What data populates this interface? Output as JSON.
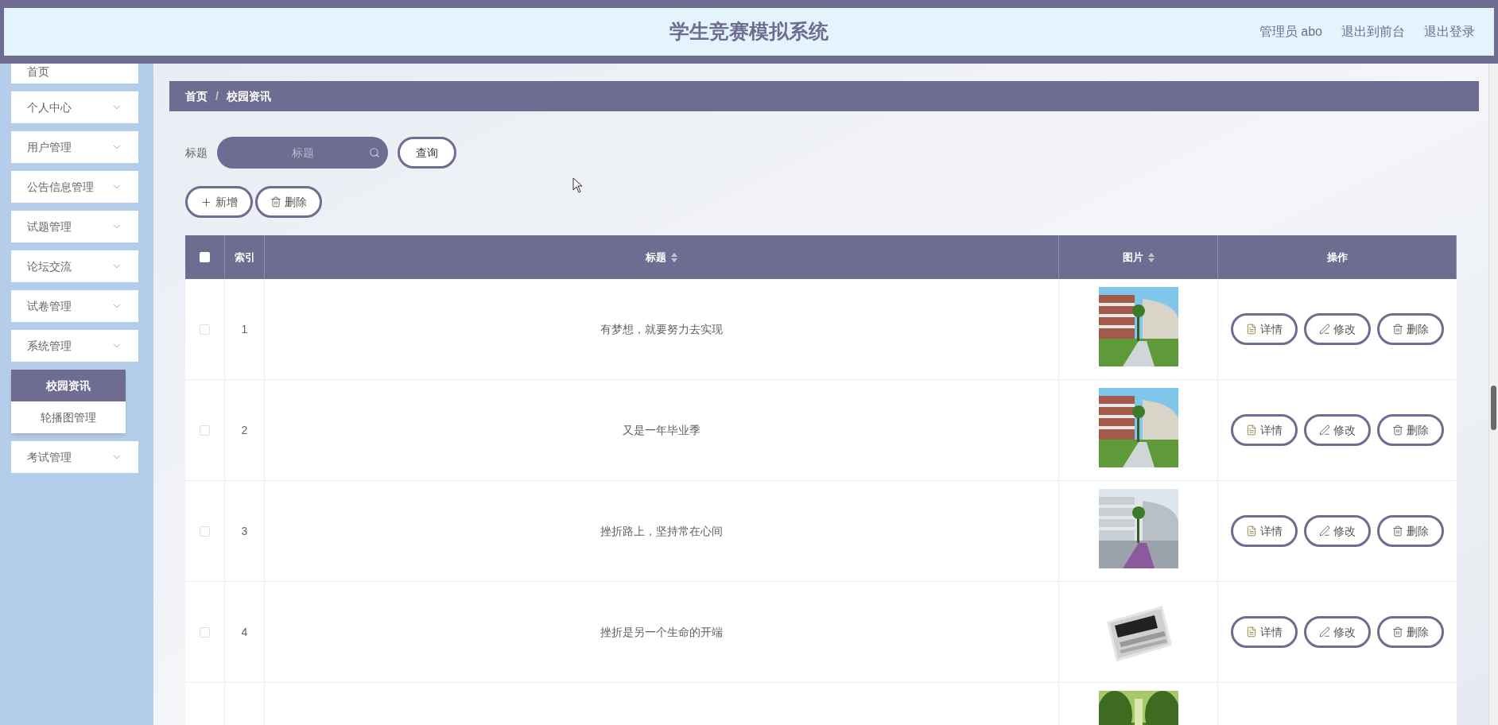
{
  "header": {
    "title": "学生竞赛模拟系统",
    "links": [
      "管理员 abo",
      "退出到前台",
      "退出登录"
    ]
  },
  "sidebar": {
    "items": [
      {
        "label": "首页",
        "kind": "plain"
      },
      {
        "label": "个人中心",
        "kind": "menu"
      },
      {
        "label": "用户管理",
        "kind": "menu"
      },
      {
        "label": "公告信息管理",
        "kind": "menu"
      },
      {
        "label": "试题管理",
        "kind": "menu"
      },
      {
        "label": "论坛交流",
        "kind": "menu"
      },
      {
        "label": "试卷管理",
        "kind": "menu"
      },
      {
        "label": "系统管理",
        "kind": "menu",
        "children": [
          {
            "label": "校园资讯",
            "selected": true
          },
          {
            "label": "轮播图管理",
            "selected": false
          }
        ]
      },
      {
        "label": "考试管理",
        "kind": "menu"
      }
    ]
  },
  "breadcrumb": {
    "items": [
      "首页",
      "校园资讯"
    ],
    "separator": "/"
  },
  "search": {
    "label": "标题",
    "placeholder": "标题",
    "button": "查询"
  },
  "actions": [
    {
      "label": "新增",
      "kind": "add"
    },
    {
      "label": "删除",
      "kind": "delete"
    }
  ],
  "table": {
    "select_all": {
      "checked": false
    },
    "columns": [
      {
        "label": "索引",
        "sortable": false
      },
      {
        "label": "标题",
        "sortable": true
      },
      {
        "label": "图片",
        "sortable": true
      },
      {
        "label": "操作",
        "sortable": false
      }
    ],
    "rows": [
      {
        "index": "1",
        "title": "有梦想，就要努力去实现",
        "checked": false,
        "picture": {
          "kind": "picture"
        },
        "actions": [
          {
            "label": "详情",
            "kind": "detail"
          },
          {
            "label": "修改",
            "kind": "edit"
          },
          {
            "label": "删除",
            "kind": "delete"
          }
        ]
      },
      {
        "index": "2",
        "title": "又是一年毕业季",
        "checked": false,
        "picture": {
          "kind": "picture"
        },
        "actions": [
          {
            "label": "详情",
            "kind": "detail"
          },
          {
            "label": "修改",
            "kind": "edit"
          },
          {
            "label": "删除",
            "kind": "delete"
          }
        ]
      },
      {
        "index": "3",
        "title": "挫折路上，坚持常在心间",
        "checked": false,
        "picture": {
          "kind": "picture"
        },
        "actions": [
          {
            "label": "详情",
            "kind": "detail"
          },
          {
            "label": "修改",
            "kind": "edit"
          },
          {
            "label": "删除",
            "kind": "delete"
          }
        ]
      },
      {
        "index": "4",
        "title": "挫折是另一个生命的开端",
        "checked": false,
        "picture": {
          "kind": "picture"
        },
        "actions": [
          {
            "label": "详情",
            "kind": "detail"
          },
          {
            "label": "修改",
            "kind": "edit"
          },
          {
            "label": "删除",
            "kind": "delete"
          }
        ]
      },
      {
        "picture": {
          "kind": "picture"
        }
      }
    ]
  }
}
